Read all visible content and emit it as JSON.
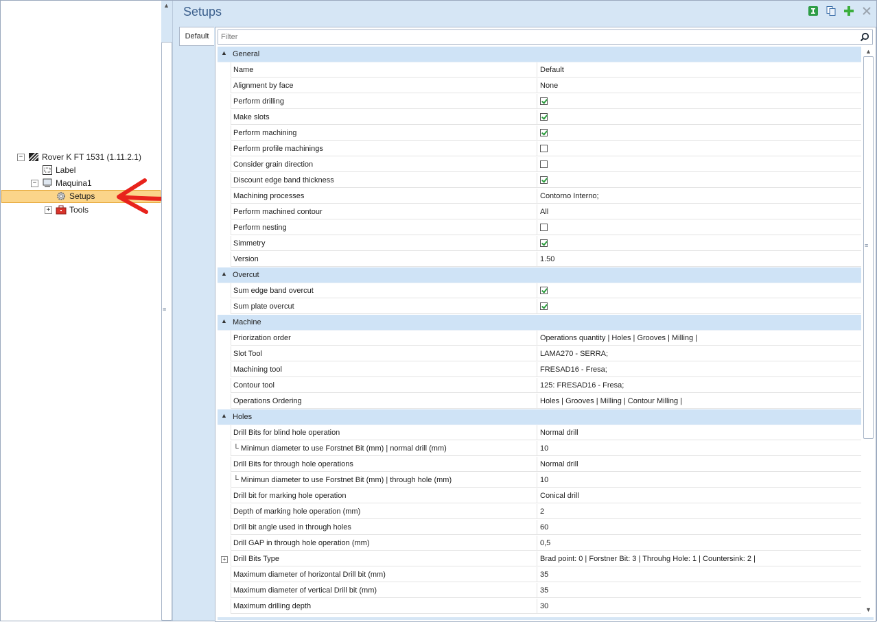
{
  "tree": {
    "root": {
      "label": "Rover K FT 1531 (1.11.2.1)",
      "expander": "−"
    },
    "label_node": {
      "label": "Label"
    },
    "machine": {
      "label": "Maquina1",
      "expander": "−"
    },
    "setups": {
      "label": "Setups"
    },
    "tools": {
      "label": "Tools",
      "expander": "+"
    }
  },
  "header": {
    "title": "Setups"
  },
  "tabs": [
    {
      "label": "Default"
    }
  ],
  "filter": {
    "placeholder": "Filter"
  },
  "categories": [
    {
      "label": "General",
      "rows": [
        {
          "name": "Name",
          "value": "Default"
        },
        {
          "name": "Alignment by face",
          "value": "None"
        },
        {
          "name": "Perform drilling",
          "checked": true
        },
        {
          "name": "Make slots",
          "checked": true
        },
        {
          "name": "Perform machining",
          "checked": true
        },
        {
          "name": "Perform profile machinings",
          "checked": false
        },
        {
          "name": "Consider grain direction",
          "checked": false
        },
        {
          "name": "Discount edge band thickness",
          "checked": true
        },
        {
          "name": "Machining processes",
          "value": "Contorno Interno;"
        },
        {
          "name": "Perform machined contour",
          "value": "All"
        },
        {
          "name": "Perform nesting",
          "checked": false
        },
        {
          "name": "Simmetry",
          "checked": true
        },
        {
          "name": "Version",
          "value": "1.50"
        }
      ]
    },
    {
      "label": "Overcut",
      "rows": [
        {
          "name": "Sum edge band overcut",
          "checked": true
        },
        {
          "name": "Sum plate overcut",
          "checked": true
        }
      ]
    },
    {
      "label": "Machine",
      "rows": [
        {
          "name": "Priorization order",
          "value": "Operations quantity | Holes | Grooves | Milling |"
        },
        {
          "name": "Slot Tool",
          "value": "LAMA270 - SERRA;"
        },
        {
          "name": "Machining tool",
          "value": "FRESAD16 - Fresa;"
        },
        {
          "name": "Contour tool",
          "value": "125: FRESAD16 - Fresa;"
        },
        {
          "name": "Operations Ordering",
          "value": "Holes | Grooves | Milling | Contour Milling |"
        }
      ]
    },
    {
      "label": "Holes",
      "rows": [
        {
          "name": "Drill Bits for blind hole operation",
          "value": "Normal drill"
        },
        {
          "name": "└ Minimun diameter to use Forstnet Bit (mm) | normal drill (mm)",
          "value": "10"
        },
        {
          "name": "Drill Bits for through hole operations",
          "value": "Normal drill"
        },
        {
          "name": "└ Minimun diameter to use Forstnet Bit (mm) | through hole (mm)",
          "value": "10"
        },
        {
          "name": "Drill bit for marking hole operation",
          "value": "Conical drill"
        },
        {
          "name": "Depth of marking hole operation (mm)",
          "value": "2"
        },
        {
          "name": "Drill bit angle used in through holes",
          "value": "60"
        },
        {
          "name": "Drill GAP in through hole operation (mm)",
          "value": "0,5"
        },
        {
          "name": "Drill Bits Type",
          "value": "Brad point: 0  |  Forstner Bit: 3  |  Throuhg Hole: 1  |  Countersink: 2  |",
          "expandable": true
        },
        {
          "name": "Maximum diameter of horizontal Drill bit (mm)",
          "value": "35"
        },
        {
          "name": "Maximum diameter of vertical Drill bit (mm)",
          "value": "35"
        },
        {
          "name": "Maximum drilling depth",
          "value": "30"
        }
      ]
    }
  ]
}
